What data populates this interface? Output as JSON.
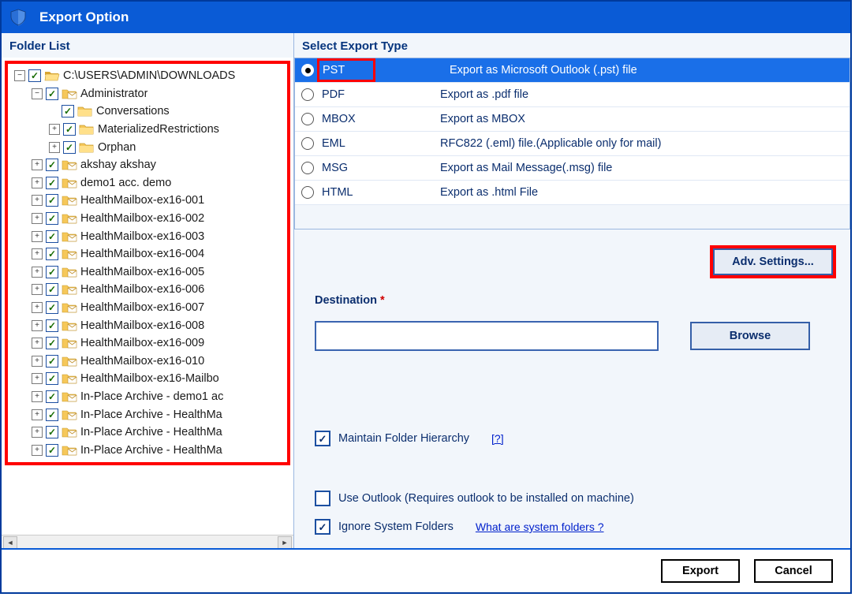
{
  "title": "Export Option",
  "left": {
    "title": "Folder List",
    "items": [
      {
        "indent": 0,
        "exp": "-",
        "checked": true,
        "icon": "open",
        "label": "C:\\USERS\\ADMIN\\DOWNLOADS"
      },
      {
        "indent": 1,
        "exp": "-",
        "checked": true,
        "icon": "mailbox",
        "label": "Administrator"
      },
      {
        "indent": 2,
        "exp": "",
        "checked": true,
        "icon": "folder",
        "label": "Conversations"
      },
      {
        "indent": 2,
        "exp": "+",
        "checked": true,
        "icon": "folder",
        "label": "MaterializedRestrictions"
      },
      {
        "indent": 2,
        "exp": "+",
        "checked": true,
        "icon": "folder",
        "label": "Orphan"
      },
      {
        "indent": 1,
        "exp": "+",
        "checked": true,
        "icon": "mailbox",
        "label": "akshay akshay"
      },
      {
        "indent": 1,
        "exp": "+",
        "checked": true,
        "icon": "mailbox",
        "label": "demo1 acc. demo"
      },
      {
        "indent": 1,
        "exp": "+",
        "checked": true,
        "icon": "mailbox",
        "label": "HealthMailbox-ex16-001"
      },
      {
        "indent": 1,
        "exp": "+",
        "checked": true,
        "icon": "mailbox",
        "label": "HealthMailbox-ex16-002"
      },
      {
        "indent": 1,
        "exp": "+",
        "checked": true,
        "icon": "mailbox",
        "label": "HealthMailbox-ex16-003"
      },
      {
        "indent": 1,
        "exp": "+",
        "checked": true,
        "icon": "mailbox",
        "label": "HealthMailbox-ex16-004"
      },
      {
        "indent": 1,
        "exp": "+",
        "checked": true,
        "icon": "mailbox",
        "label": "HealthMailbox-ex16-005"
      },
      {
        "indent": 1,
        "exp": "+",
        "checked": true,
        "icon": "mailbox",
        "label": "HealthMailbox-ex16-006"
      },
      {
        "indent": 1,
        "exp": "+",
        "checked": true,
        "icon": "mailbox",
        "label": "HealthMailbox-ex16-007"
      },
      {
        "indent": 1,
        "exp": "+",
        "checked": true,
        "icon": "mailbox",
        "label": "HealthMailbox-ex16-008"
      },
      {
        "indent": 1,
        "exp": "+",
        "checked": true,
        "icon": "mailbox",
        "label": "HealthMailbox-ex16-009"
      },
      {
        "indent": 1,
        "exp": "+",
        "checked": true,
        "icon": "mailbox",
        "label": "HealthMailbox-ex16-010"
      },
      {
        "indent": 1,
        "exp": "+",
        "checked": true,
        "icon": "mailbox",
        "label": "HealthMailbox-ex16-Mailbo"
      },
      {
        "indent": 1,
        "exp": "+",
        "checked": true,
        "icon": "mailbox",
        "label": "In-Place Archive - demo1 ac"
      },
      {
        "indent": 1,
        "exp": "+",
        "checked": true,
        "icon": "mailbox",
        "label": "In-Place Archive - HealthMa"
      },
      {
        "indent": 1,
        "exp": "+",
        "checked": true,
        "icon": "mailbox",
        "label": "In-Place Archive - HealthMa"
      },
      {
        "indent": 1,
        "exp": "+",
        "checked": true,
        "icon": "mailbox",
        "label": "In-Place Archive - HealthMa"
      }
    ]
  },
  "right": {
    "title": "Select Export Type",
    "types": [
      {
        "name": "PST",
        "desc": "Export as Microsoft Outlook (.pst) file",
        "selected": true
      },
      {
        "name": "PDF",
        "desc": "Export as .pdf file",
        "selected": false
      },
      {
        "name": "MBOX",
        "desc": "Export as MBOX",
        "selected": false
      },
      {
        "name": "EML",
        "desc": "RFC822 (.eml) file.(Applicable only for mail)",
        "selected": false
      },
      {
        "name": "MSG",
        "desc": "Export as Mail Message(.msg) file",
        "selected": false
      },
      {
        "name": "HTML",
        "desc": "Export as .html File",
        "selected": false
      }
    ],
    "adv_settings": "Adv. Settings...",
    "destination_label": "Destination",
    "destination_value": "",
    "browse": "Browse",
    "opts": {
      "maintain": "Maintain Folder Hierarchy",
      "maintain_checked": true,
      "help_qmark": "[?]",
      "use_outlook": "Use Outlook (Requires outlook to be installed on machine)",
      "use_outlook_checked": false,
      "ignore_sys": "Ignore System Folders",
      "ignore_sys_checked": true,
      "sys_link": "What are system folders ?"
    }
  },
  "footer": {
    "export": "Export",
    "cancel": "Cancel"
  }
}
